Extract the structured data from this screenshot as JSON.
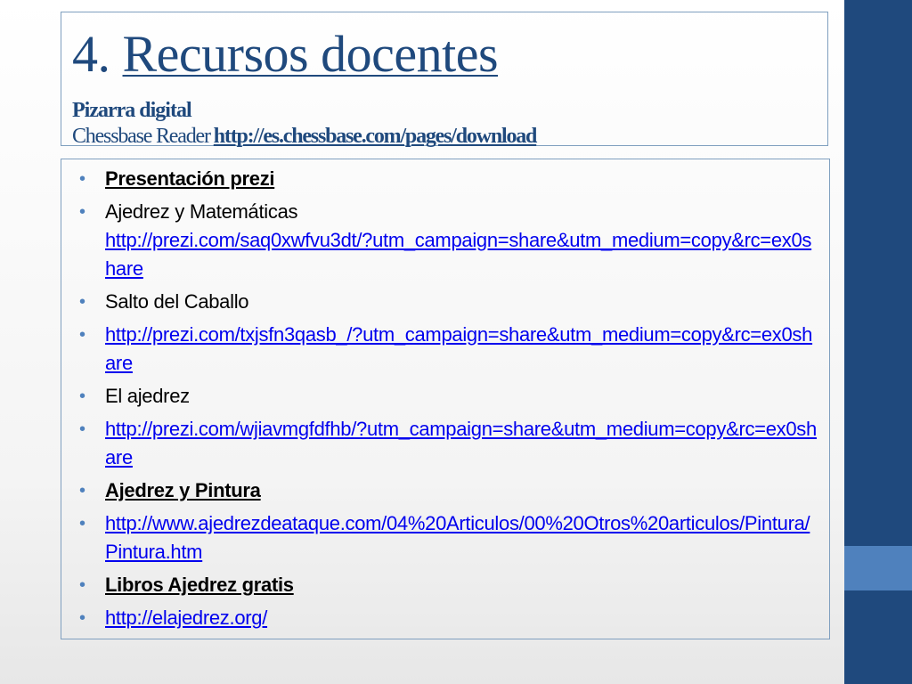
{
  "title": {
    "number": "4.",
    "text": "Recursos docentes"
  },
  "subtitle": {
    "line1": "Pizarra digital",
    "line2_text": "Chessbase Reader",
    "line2_link": "http://es.chessbase.com/pages/download"
  },
  "items": [
    {
      "style": "bold",
      "text": "Presentación prezi"
    },
    {
      "style": "label-link",
      "text": "Ajedrez y Matemáticas",
      "link": "http://prezi.com/saq0xwfvu3dt/?utm_campaign=share&utm_medium=copy&rc=ex0share"
    },
    {
      "style": "plain",
      "text": "Salto del Caballo"
    },
    {
      "style": "link",
      "text": "http://prezi.com/txjsfn3qasb_/?utm_campaign=share&utm_medium=copy&rc=ex0share"
    },
    {
      "style": "plain",
      "text": "El ajedrez"
    },
    {
      "style": "link",
      "text": "http://prezi.com/wjiavmgfdfhb/?utm_campaign=share&utm_medium=copy&rc=ex0share"
    },
    {
      "style": "bold",
      "text": "Ajedrez y Pintura"
    },
    {
      "style": "link",
      "text": "http://www.ajedrezdeataque.com/04%20Articulos/00%20Otros%20articulos/Pintura/Pintura.htm"
    },
    {
      "style": "bold",
      "text": "Libros Ajedrez gratis"
    },
    {
      "style": "link",
      "text": "http://elajedrez.org/"
    }
  ],
  "colors": {
    "title": "#1f497d",
    "sidebar": "#1f497d",
    "sidebar_accent": "#4f81bd",
    "bullet": "#4f81bd",
    "link": "#0000ee"
  }
}
